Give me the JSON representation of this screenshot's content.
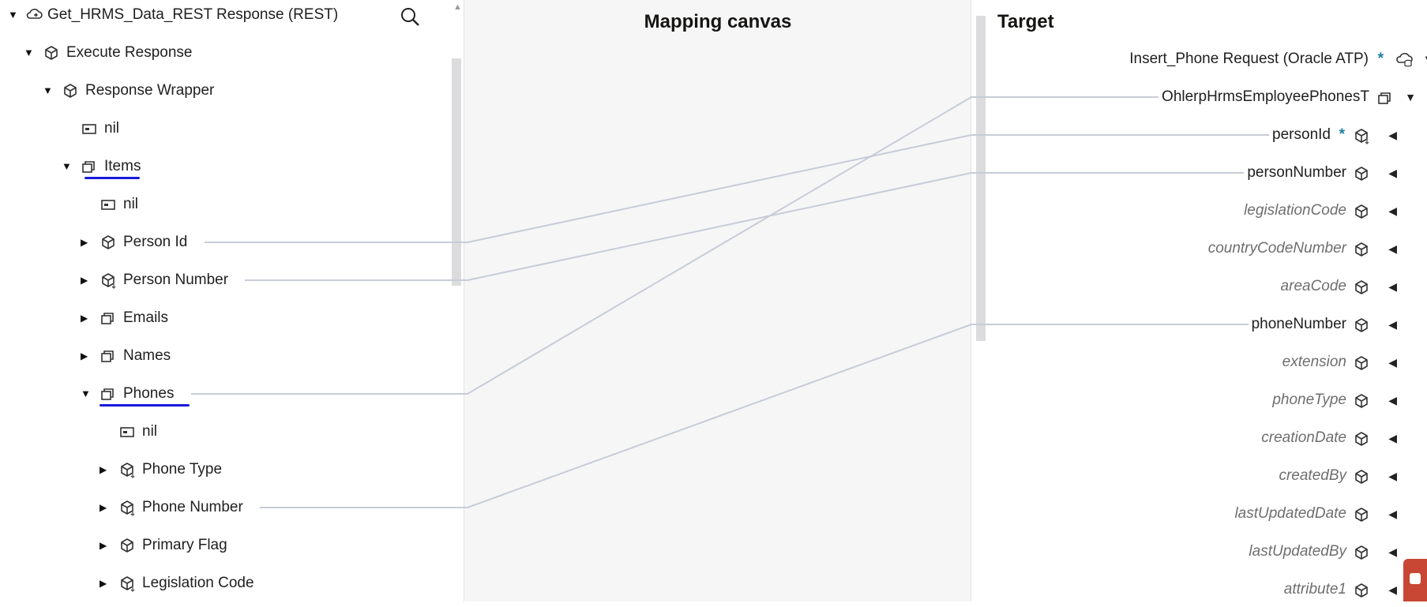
{
  "source": {
    "title": "Get_HRMS_Data_REST Response (REST)",
    "required_marker": "*",
    "nodes": [
      {
        "label": "Execute Response",
        "level": 1,
        "expander": "open",
        "icon": "cube-icon",
        "required": true
      },
      {
        "label": "Response Wrapper",
        "level": 2,
        "expander": "open",
        "icon": "cube-icon",
        "required": true
      },
      {
        "label": "nil",
        "level": 3,
        "expander": "none",
        "icon": "attribute-icon",
        "required": false
      },
      {
        "label": "Items",
        "level": 3,
        "expander": "open",
        "icon": "collection-icon",
        "required": true
      },
      {
        "label": "nil",
        "level": 4,
        "expander": "none",
        "icon": "attribute-icon",
        "required": false
      },
      {
        "label": "Person Id",
        "level": 4,
        "expander": "closed",
        "icon": "cube-icon",
        "required": true
      },
      {
        "label": "Person Number",
        "level": 4,
        "expander": "closed",
        "icon": "cube-down-icon",
        "required": true
      },
      {
        "label": "Emails",
        "level": 4,
        "expander": "closed",
        "icon": "collection-icon",
        "required": true
      },
      {
        "label": "Names",
        "level": 4,
        "expander": "closed",
        "icon": "collection-icon",
        "required": true
      },
      {
        "label": "Phones",
        "level": 4,
        "expander": "open",
        "icon": "collection-icon",
        "required": true
      },
      {
        "label": "nil",
        "level": 5,
        "expander": "none",
        "icon": "attribute-icon",
        "required": false
      },
      {
        "label": "Phone Type",
        "level": 5,
        "expander": "closed",
        "icon": "cube-down-icon",
        "required": true
      },
      {
        "label": "Phone Number",
        "level": 5,
        "expander": "closed",
        "icon": "cube-down-icon",
        "required": true
      },
      {
        "label": "Primary Flag",
        "level": 5,
        "expander": "closed",
        "icon": "cube-icon",
        "required": true
      },
      {
        "label": "Legislation Code",
        "level": 5,
        "expander": "closed",
        "icon": "cube-down-icon",
        "required": true
      }
    ]
  },
  "canvas": {
    "title": "Mapping canvas"
  },
  "target": {
    "title": "Target",
    "root_label": "Insert_Phone Request (Oracle ATP)",
    "nodes": [
      {
        "label": "OhlerpHrmsEmployeePhonesT",
        "icon": "collection-icon",
        "required": false,
        "optional": false,
        "expander": "open"
      },
      {
        "label": "personId",
        "icon": "cube-down-icon",
        "required": true,
        "optional": false,
        "expander": "left"
      },
      {
        "label": "personNumber",
        "icon": "cube-icon",
        "required": false,
        "optional": false,
        "expander": "left"
      },
      {
        "label": "legislationCode",
        "icon": "cube-icon",
        "required": false,
        "optional": true,
        "expander": "left"
      },
      {
        "label": "countryCodeNumber",
        "icon": "cube-icon",
        "required": false,
        "optional": true,
        "expander": "left"
      },
      {
        "label": "areaCode",
        "icon": "cube-icon",
        "required": false,
        "optional": true,
        "expander": "left"
      },
      {
        "label": "phoneNumber",
        "icon": "cube-icon",
        "required": false,
        "optional": false,
        "expander": "left"
      },
      {
        "label": "extension",
        "icon": "cube-icon",
        "required": false,
        "optional": true,
        "expander": "left"
      },
      {
        "label": "phoneType",
        "icon": "cube-icon",
        "required": false,
        "optional": true,
        "expander": "left"
      },
      {
        "label": "creationDate",
        "icon": "cube-icon",
        "required": false,
        "optional": true,
        "expander": "left"
      },
      {
        "label": "createdBy",
        "icon": "cube-icon",
        "required": false,
        "optional": true,
        "expander": "left"
      },
      {
        "label": "lastUpdatedDate",
        "icon": "cube-icon",
        "required": false,
        "optional": true,
        "expander": "left"
      },
      {
        "label": "lastUpdatedBy",
        "icon": "cube-icon",
        "required": false,
        "optional": true,
        "expander": "left"
      },
      {
        "label": "attribute1",
        "icon": "cube-icon",
        "required": false,
        "optional": true,
        "expander": "left"
      }
    ]
  },
  "mappings": [
    {
      "from": "Person Id",
      "to": "personId"
    },
    {
      "from": "Person Number",
      "to": "personNumber"
    },
    {
      "from": "Phones",
      "to": "OhlerpHrmsEmployeePhonesT"
    },
    {
      "from": "Phone Number",
      "to": "phoneNumber"
    }
  ],
  "colors": {
    "accent": "#1a7f9c",
    "annotation": "#1a1adc",
    "mapping_line": "#c7ccd6",
    "chat_badge": "#c74634"
  }
}
